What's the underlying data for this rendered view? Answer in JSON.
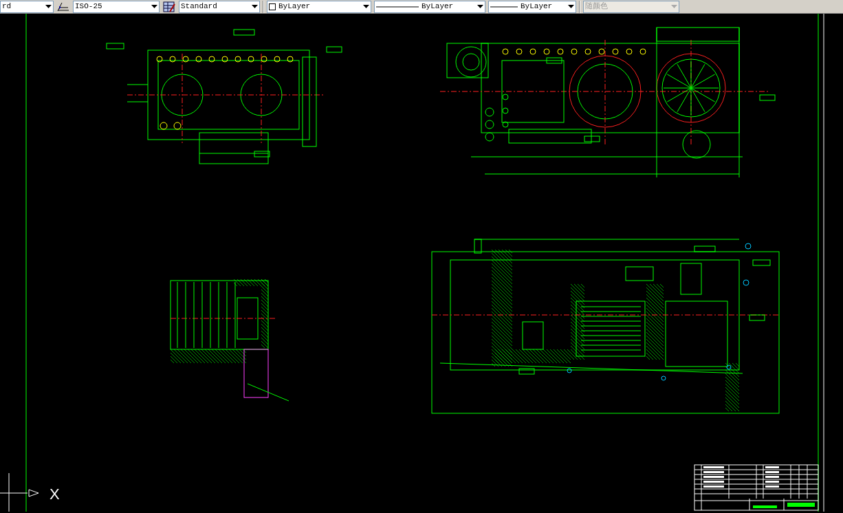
{
  "toolbar": {
    "combos": [
      {
        "kind": "plain",
        "text": "rd",
        "disabled": false
      },
      {
        "kind": "dim-style",
        "text": "ISO-25",
        "disabled": false
      },
      {
        "kind": "table-style",
        "text": "Standard",
        "disabled": false
      },
      {
        "kind": "color",
        "text": "ByLayer",
        "disabled": false
      },
      {
        "kind": "linetype",
        "text": "ByLayer",
        "disabled": false
      },
      {
        "kind": "lineweight",
        "text": "ByLayer",
        "disabled": false
      },
      {
        "kind": "plot-style",
        "text": "随颜色",
        "disabled": true
      }
    ]
  },
  "canvas": {
    "ucs_axis_label": "X"
  }
}
